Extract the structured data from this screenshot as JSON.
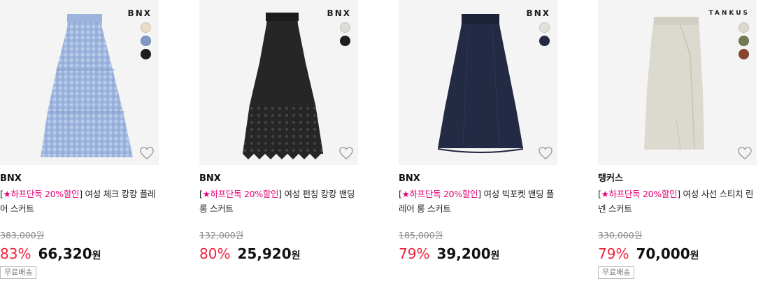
{
  "products": [
    {
      "logo": "BNX",
      "swatches": [
        "#e9ddc9",
        "#7f99c2",
        "#1e1e1e"
      ],
      "brand": "BNX",
      "title_prefix": "[",
      "title_promo": "★하프단독 20%할인",
      "title_rest": "] 여성 체크 캉캉 플레어 스커트",
      "original_price": "383,000원",
      "discount": "83%",
      "price": "66,320",
      "won": "원",
      "badge": "무료배송",
      "favorite_icon": "heart-outline-icon"
    },
    {
      "logo": "BNX",
      "swatches": [
        "#dddcd6",
        "#1f1f1f"
      ],
      "brand": "BNX",
      "title_prefix": "[",
      "title_promo": "★하프단독 20%할인",
      "title_rest": "] 여성 펀칭 캉캉 밴딩 롱 스커트",
      "original_price": "132,000원",
      "discount": "80%",
      "price": "25,920",
      "won": "원",
      "badge": "",
      "favorite_icon": "heart-outline-icon"
    },
    {
      "logo": "BNX",
      "swatches": [
        "#e2e0da",
        "#232a44"
      ],
      "brand": "BNX",
      "title_prefix": "[",
      "title_promo": "★하프단독 20%할인",
      "title_rest": "] 여성 빅포켓 밴딩 플레어 롱 스커트",
      "original_price": "185,000원",
      "discount": "79%",
      "price": "39,200",
      "won": "원",
      "badge": "",
      "favorite_icon": "heart-outline-icon"
    },
    {
      "logo": "TANKUS",
      "swatches": [
        "#ddd9cf",
        "#737a52",
        "#8a4530"
      ],
      "brand": "탱커스",
      "title_prefix": "[",
      "title_promo": "★하프단독 20%할인",
      "title_rest": "] 여성 사선 스티치 린넨 스커트",
      "original_price": "330,000원",
      "discount": "79%",
      "price": "70,000",
      "won": "원",
      "badge": "무료배송",
      "favorite_icon": "heart-outline-icon"
    }
  ],
  "colors": {
    "promo": "#e60073",
    "discount": "#f0233b",
    "skirt_check": "#a9bde0",
    "skirt_lace": "#222222",
    "skirt_navy": "#232a44",
    "skirt_linen": "#dcd9cf"
  }
}
